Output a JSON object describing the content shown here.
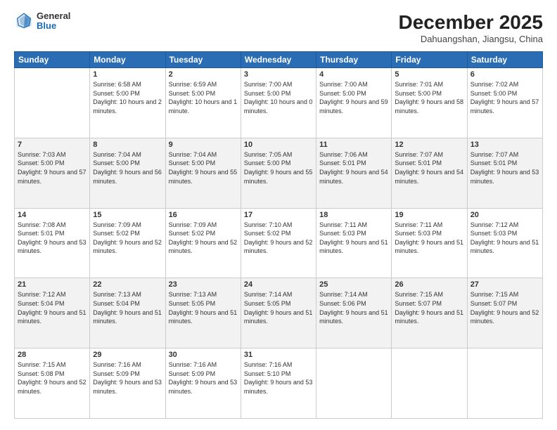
{
  "header": {
    "logo": {
      "general": "General",
      "blue": "Blue"
    },
    "title": "December 2025",
    "location": "Dahuangshan, Jiangsu, China"
  },
  "days_of_week": [
    "Sunday",
    "Monday",
    "Tuesday",
    "Wednesday",
    "Thursday",
    "Friday",
    "Saturday"
  ],
  "weeks": [
    [
      null,
      {
        "day": 1,
        "sunrise": "6:58 AM",
        "sunset": "5:00 PM",
        "daylight": "10 hours and 2 minutes."
      },
      {
        "day": 2,
        "sunrise": "6:59 AM",
        "sunset": "5:00 PM",
        "daylight": "10 hours and 1 minute."
      },
      {
        "day": 3,
        "sunrise": "7:00 AM",
        "sunset": "5:00 PM",
        "daylight": "10 hours and 0 minutes."
      },
      {
        "day": 4,
        "sunrise": "7:00 AM",
        "sunset": "5:00 PM",
        "daylight": "9 hours and 59 minutes."
      },
      {
        "day": 5,
        "sunrise": "7:01 AM",
        "sunset": "5:00 PM",
        "daylight": "9 hours and 58 minutes."
      },
      {
        "day": 6,
        "sunrise": "7:02 AM",
        "sunset": "5:00 PM",
        "daylight": "9 hours and 57 minutes."
      }
    ],
    [
      {
        "day": 7,
        "sunrise": "7:03 AM",
        "sunset": "5:00 PM",
        "daylight": "9 hours and 57 minutes."
      },
      {
        "day": 8,
        "sunrise": "7:04 AM",
        "sunset": "5:00 PM",
        "daylight": "9 hours and 56 minutes."
      },
      {
        "day": 9,
        "sunrise": "7:04 AM",
        "sunset": "5:00 PM",
        "daylight": "9 hours and 55 minutes."
      },
      {
        "day": 10,
        "sunrise": "7:05 AM",
        "sunset": "5:00 PM",
        "daylight": "9 hours and 55 minutes."
      },
      {
        "day": 11,
        "sunrise": "7:06 AM",
        "sunset": "5:01 PM",
        "daylight": "9 hours and 54 minutes."
      },
      {
        "day": 12,
        "sunrise": "7:07 AM",
        "sunset": "5:01 PM",
        "daylight": "9 hours and 54 minutes."
      },
      {
        "day": 13,
        "sunrise": "7:07 AM",
        "sunset": "5:01 PM",
        "daylight": "9 hours and 53 minutes."
      }
    ],
    [
      {
        "day": 14,
        "sunrise": "7:08 AM",
        "sunset": "5:01 PM",
        "daylight": "9 hours and 53 minutes."
      },
      {
        "day": 15,
        "sunrise": "7:09 AM",
        "sunset": "5:02 PM",
        "daylight": "9 hours and 52 minutes."
      },
      {
        "day": 16,
        "sunrise": "7:09 AM",
        "sunset": "5:02 PM",
        "daylight": "9 hours and 52 minutes."
      },
      {
        "day": 17,
        "sunrise": "7:10 AM",
        "sunset": "5:02 PM",
        "daylight": "9 hours and 52 minutes."
      },
      {
        "day": 18,
        "sunrise": "7:11 AM",
        "sunset": "5:03 PM",
        "daylight": "9 hours and 51 minutes."
      },
      {
        "day": 19,
        "sunrise": "7:11 AM",
        "sunset": "5:03 PM",
        "daylight": "9 hours and 51 minutes."
      },
      {
        "day": 20,
        "sunrise": "7:12 AM",
        "sunset": "5:03 PM",
        "daylight": "9 hours and 51 minutes."
      }
    ],
    [
      {
        "day": 21,
        "sunrise": "7:12 AM",
        "sunset": "5:04 PM",
        "daylight": "9 hours and 51 minutes."
      },
      {
        "day": 22,
        "sunrise": "7:13 AM",
        "sunset": "5:04 PM",
        "daylight": "9 hours and 51 minutes."
      },
      {
        "day": 23,
        "sunrise": "7:13 AM",
        "sunset": "5:05 PM",
        "daylight": "9 hours and 51 minutes."
      },
      {
        "day": 24,
        "sunrise": "7:14 AM",
        "sunset": "5:05 PM",
        "daylight": "9 hours and 51 minutes."
      },
      {
        "day": 25,
        "sunrise": "7:14 AM",
        "sunset": "5:06 PM",
        "daylight": "9 hours and 51 minutes."
      },
      {
        "day": 26,
        "sunrise": "7:15 AM",
        "sunset": "5:07 PM",
        "daylight": "9 hours and 51 minutes."
      },
      {
        "day": 27,
        "sunrise": "7:15 AM",
        "sunset": "5:07 PM",
        "daylight": "9 hours and 52 minutes."
      }
    ],
    [
      {
        "day": 28,
        "sunrise": "7:15 AM",
        "sunset": "5:08 PM",
        "daylight": "9 hours and 52 minutes."
      },
      {
        "day": 29,
        "sunrise": "7:16 AM",
        "sunset": "5:09 PM",
        "daylight": "9 hours and 53 minutes."
      },
      {
        "day": 30,
        "sunrise": "7:16 AM",
        "sunset": "5:09 PM",
        "daylight": "9 hours and 53 minutes."
      },
      {
        "day": 31,
        "sunrise": "7:16 AM",
        "sunset": "5:10 PM",
        "daylight": "9 hours and 53 minutes."
      },
      null,
      null,
      null
    ]
  ]
}
